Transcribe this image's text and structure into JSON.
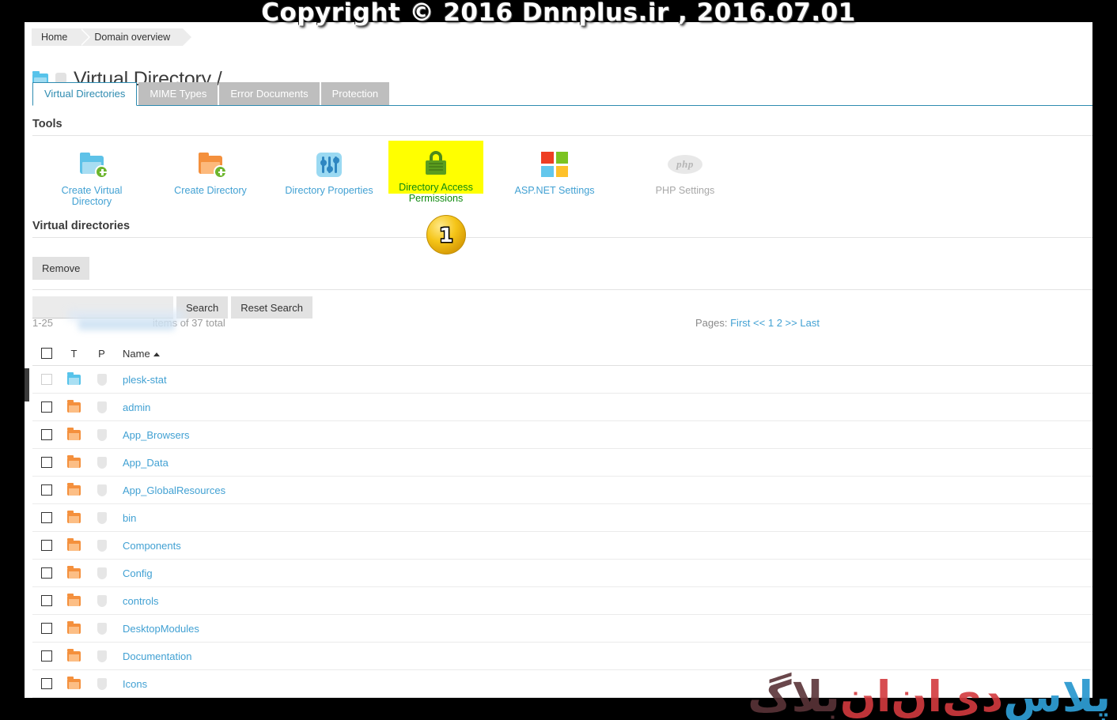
{
  "watermark": {
    "top": "Copyright © 2016 Dnnplus.ir , 2016.07.01",
    "logo_part1": "بلاگ",
    "logo_part2": "دی‌ان‌ان",
    "logo_part3": "پلاس"
  },
  "breadcrumb": {
    "items": [
      {
        "label": "Home"
      },
      {
        "label": "Domain overview"
      }
    ]
  },
  "header": {
    "title": "Virtual Directory /",
    "folder_icon": "folder-icon",
    "shield_icon": "shield-icon"
  },
  "tabs": [
    {
      "label": "Virtual Directories",
      "active": true
    },
    {
      "label": "MIME Types",
      "active": false
    },
    {
      "label": "Error Documents",
      "active": false
    },
    {
      "label": "Protection",
      "active": false
    }
  ],
  "sections": {
    "tools_heading": "Tools",
    "virtual_directories_heading": "Virtual directories"
  },
  "tools": [
    {
      "label": "Create Virtual Directory",
      "icon": "folder-blue-add-icon",
      "state": "enabled",
      "highlighted": false
    },
    {
      "label": "Create Directory",
      "icon": "folder-orange-add-icon",
      "state": "enabled",
      "highlighted": false
    },
    {
      "label": "Directory Properties",
      "icon": "sliders-icon",
      "state": "enabled",
      "highlighted": false
    },
    {
      "label": "Directory Access Permissions",
      "icon": "lock-icon",
      "state": "enabled",
      "highlighted": true
    },
    {
      "label": "ASP.NET Settings",
      "icon": "microsoft-squares-icon",
      "state": "enabled",
      "highlighted": false
    },
    {
      "label": "PHP Settings",
      "icon": "php-icon",
      "state": "disabled",
      "highlighted": false
    }
  ],
  "step_marker": {
    "number": "1"
  },
  "actions": {
    "remove_label": "Remove"
  },
  "search": {
    "value": "",
    "placeholder": "",
    "search_label": "Search",
    "reset_label": "Reset Search"
  },
  "listinfo": {
    "range": "1-25",
    "redacted": "",
    "suffix": "items of 37 total"
  },
  "pagination": {
    "label": "Pages:",
    "first": "First",
    "prev": "<<",
    "page1": "1",
    "page2": "2",
    "next": ">>",
    "last": "Last"
  },
  "table": {
    "columns": {
      "check": "",
      "t": "T",
      "p": "P",
      "name": "Name"
    },
    "sort": {
      "column": "Name",
      "direction": "asc"
    },
    "rows": [
      {
        "name": "plesk-stat",
        "folder": "blue",
        "checkbox": "disabled",
        "shield": true
      },
      {
        "name": "admin",
        "folder": "orange",
        "checkbox": "enabled",
        "shield": true
      },
      {
        "name": "App_Browsers",
        "folder": "orange",
        "checkbox": "enabled",
        "shield": true
      },
      {
        "name": "App_Data",
        "folder": "orange",
        "checkbox": "enabled",
        "shield": true
      },
      {
        "name": "App_GlobalResources",
        "folder": "orange",
        "checkbox": "enabled",
        "shield": true
      },
      {
        "name": "bin",
        "folder": "orange",
        "checkbox": "enabled",
        "shield": true
      },
      {
        "name": "Components",
        "folder": "orange",
        "checkbox": "enabled",
        "shield": true
      },
      {
        "name": "Config",
        "folder": "orange",
        "checkbox": "enabled",
        "shield": true
      },
      {
        "name": "controls",
        "folder": "orange",
        "checkbox": "enabled",
        "shield": true
      },
      {
        "name": "DesktopModules",
        "folder": "orange",
        "checkbox": "enabled",
        "shield": true
      },
      {
        "name": "Documentation",
        "folder": "orange",
        "checkbox": "enabled",
        "shield": true
      },
      {
        "name": "Icons",
        "folder": "orange",
        "checkbox": "enabled",
        "shield": true
      }
    ]
  },
  "colors": {
    "accent": "#42a1d3",
    "tab_active_border": "#2e8bb0",
    "highlight": "#ffff00",
    "highlight_text": "#0f8a0f",
    "folder_orange": "#f4903d",
    "folder_blue": "#57c3ea",
    "badge_gold": "#f5c518",
    "ms_red": "#ee3e23",
    "ms_green": "#7cc322",
    "ms_blue": "#63c7ec",
    "ms_yellow": "#fec12a"
  }
}
